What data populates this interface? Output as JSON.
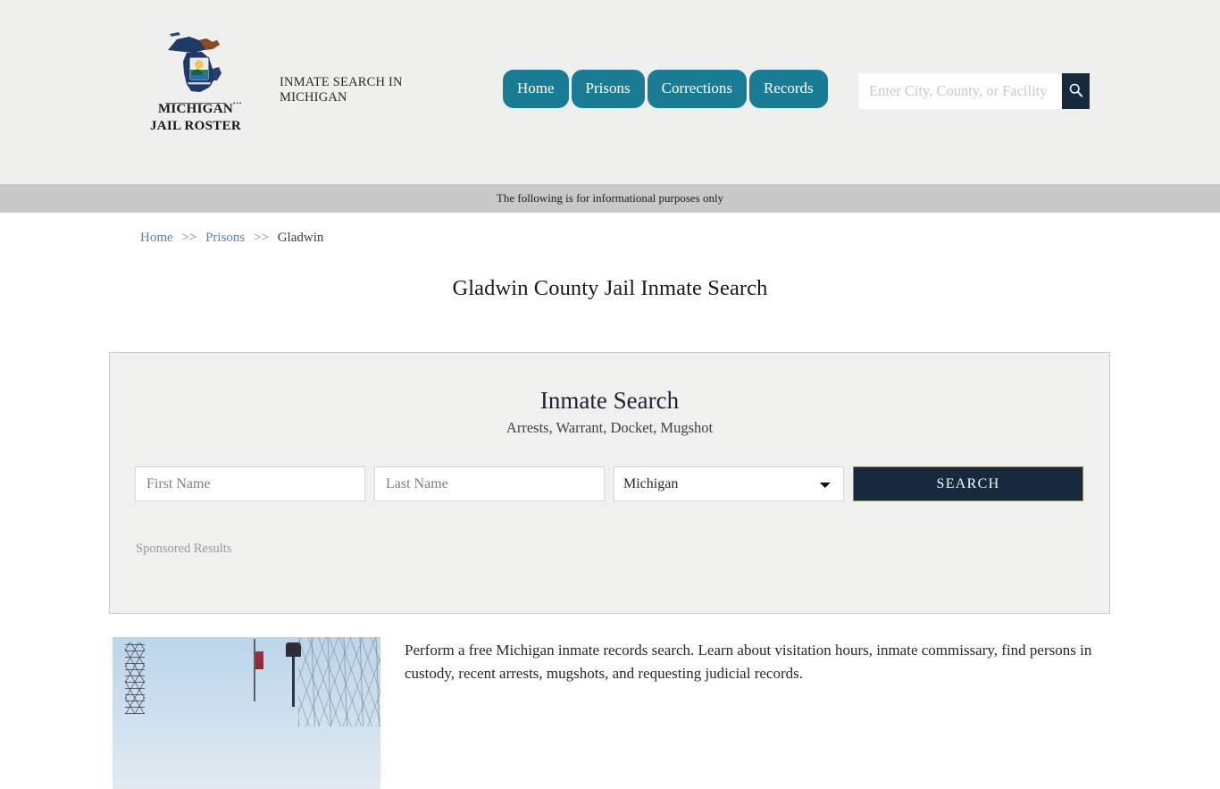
{
  "header": {
    "brand": {
      "icon": "michigan-state-outline-icon",
      "line1": "MICHIGAN",
      "line2": "JAIL ROSTER"
    },
    "tagline": "INMATE SEARCH IN MICHIGAN",
    "nav": [
      {
        "label": "Home"
      },
      {
        "label": "Prisons"
      },
      {
        "label": "Corrections"
      },
      {
        "label": "Records"
      }
    ],
    "search": {
      "value": "",
      "placeholder": "Enter City, County, or Facility",
      "button_icon": "search-icon"
    },
    "colors": {
      "nav_tab": "#1a7c94",
      "header_bg": "#efefee",
      "search_button": "#17293c"
    }
  },
  "info_banner": {
    "text": "The following is for informational purposes only",
    "bg": "#c8c8c8"
  },
  "breadcrumb": {
    "items": [
      {
        "label": "Home",
        "link": true
      },
      {
        "label": "Prisons",
        "link": true
      },
      {
        "label": "Gladwin",
        "link": false
      }
    ],
    "separator": ">>"
  },
  "page": {
    "title": "Gladwin County Jail Inmate Search"
  },
  "search_panel": {
    "title": "Inmate Search",
    "subtitle": "Arrests, Warrant, Docket, Mugshot",
    "first_name": {
      "value": "",
      "placeholder": "First Name"
    },
    "last_name": {
      "value": "",
      "placeholder": "Last Name"
    },
    "state": {
      "selected": "Michigan",
      "options": [
        "Michigan"
      ]
    },
    "submit_label": "SEARCH",
    "sponsored_label": "Sponsored Results",
    "colors": {
      "panel_bg": "#f0f0ef",
      "panel_border": "#c9c9c9",
      "submit_bg": "#17293c"
    }
  },
  "content": {
    "photo_alt": "gladwin-county-street-photo",
    "paragraph": "Perform a free Michigan inmate records search. Learn about visitation hours, inmate commissary, find persons in custody, recent arrests, mugshots, and requesting judicial records."
  }
}
